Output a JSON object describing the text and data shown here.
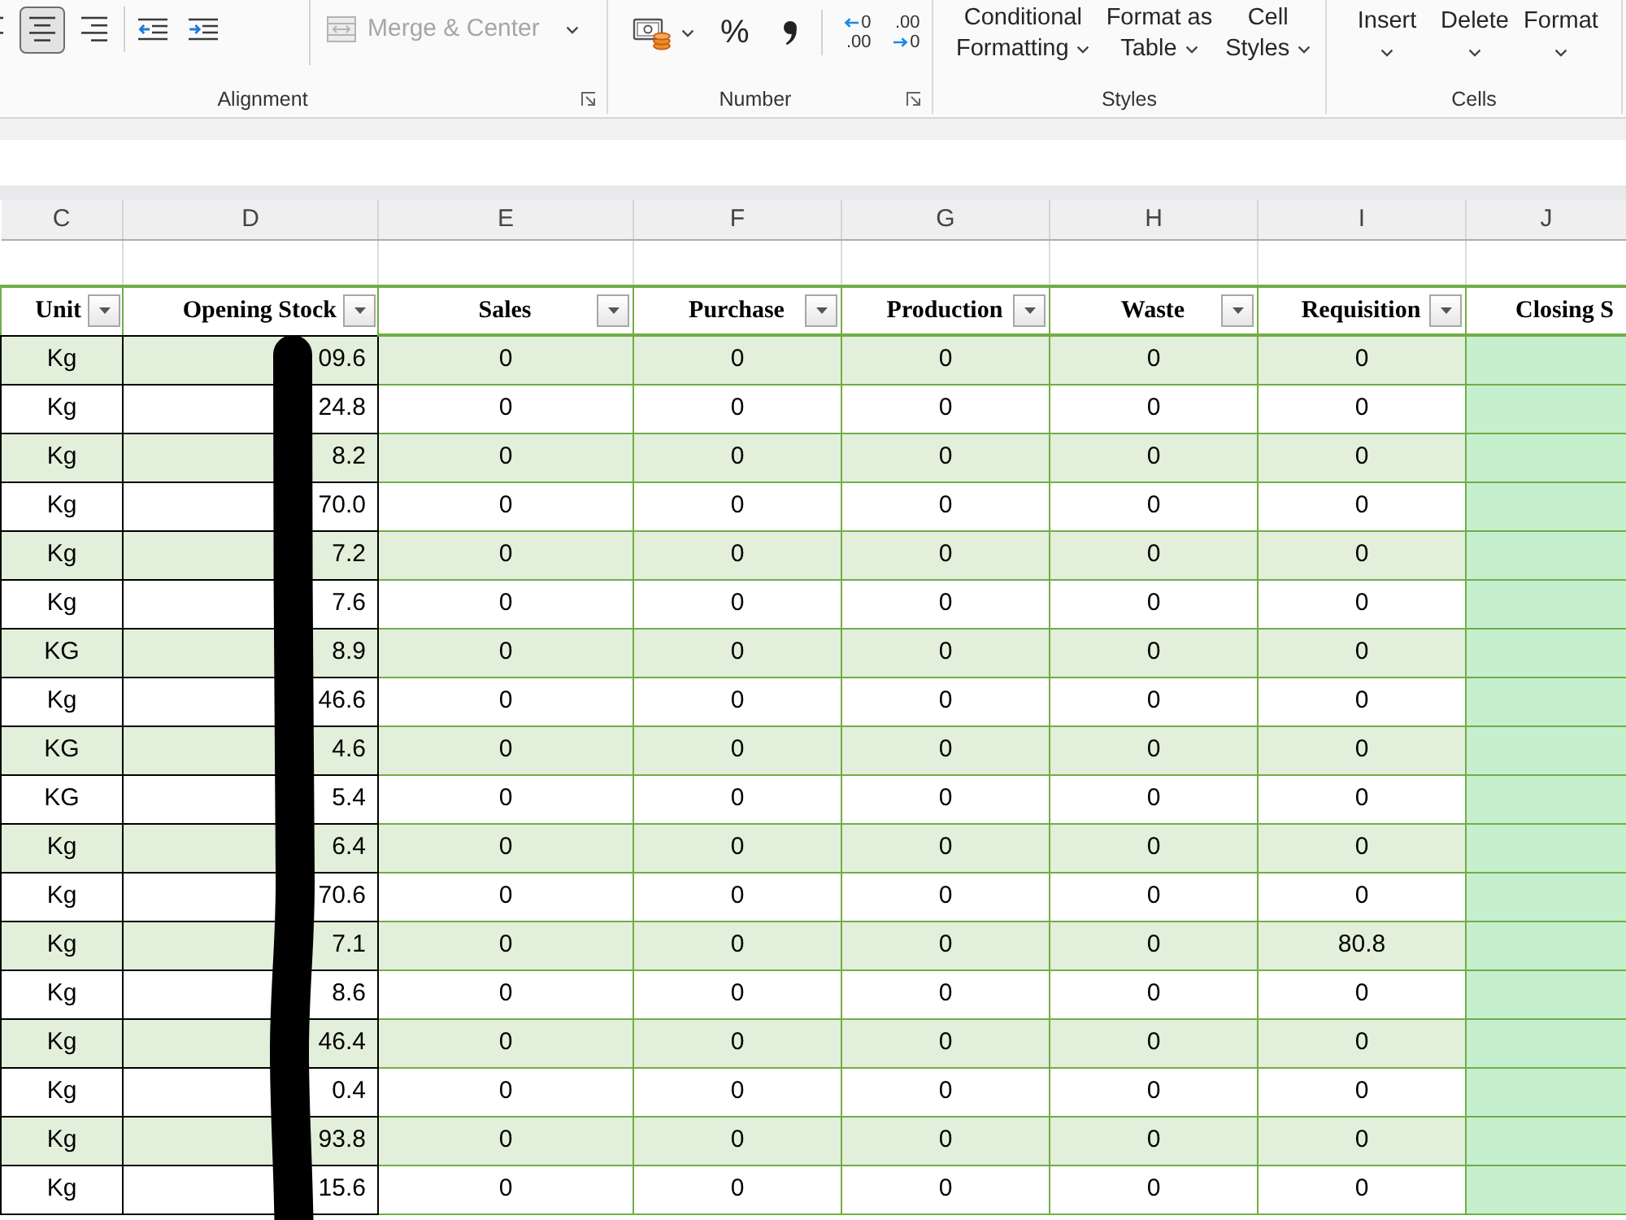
{
  "ribbon": {
    "groups": [
      {
        "kind": "alignment",
        "label": "Alignment",
        "launcher": true,
        "align_buttons": [
          {
            "kind": "left",
            "selected": false
          },
          {
            "kind": "center",
            "selected": true
          },
          {
            "kind": "right",
            "selected": false
          }
        ],
        "indent_buttons": [
          {
            "kind": "decrease"
          },
          {
            "kind": "increase"
          }
        ],
        "merge": {
          "label": "Merge & Center",
          "disabled": true
        }
      },
      {
        "kind": "number",
        "label": "Number",
        "launcher": true,
        "percent": "%",
        "decimal_buttons": [
          {
            "kind": "increase",
            "lines": [
              "0",
              ".00"
            ]
          },
          {
            "kind": "decrease",
            "lines": [
              ".00",
              "0"
            ]
          }
        ]
      },
      {
        "kind": "styles",
        "label": "Styles",
        "launcher": false,
        "buttons": [
          {
            "lines": [
              "Conditional",
              "Formatting"
            ]
          },
          {
            "lines": [
              "Format as",
              "Table"
            ]
          },
          {
            "lines": [
              "Cell",
              "Styles"
            ]
          }
        ]
      },
      {
        "kind": "cells",
        "label": "Cells",
        "launcher": false,
        "buttons": [
          {
            "label": "Insert"
          },
          {
            "label": "Delete"
          },
          {
            "label": "Format"
          }
        ]
      }
    ]
  },
  "sheet": {
    "column_letters": [
      "C",
      "D",
      "E",
      "F",
      "G",
      "H",
      "I",
      "J"
    ],
    "headers": [
      {
        "label": "Unit",
        "filter": true
      },
      {
        "label": "Opening Stock",
        "filter": true
      },
      {
        "label": "Sales",
        "filter": true
      },
      {
        "label": "Purchase",
        "filter": true
      },
      {
        "label": "Production",
        "filter": true
      },
      {
        "label": "Waste",
        "filter": true
      },
      {
        "label": "Requisition",
        "filter": true
      },
      {
        "label": "Closing S",
        "filter": false
      }
    ],
    "rows": [
      [
        "Kg",
        "09.6",
        "0",
        "0",
        "0",
        "0",
        "0"
      ],
      [
        "Kg",
        "24.8",
        "0",
        "0",
        "0",
        "0",
        "0"
      ],
      [
        "Kg",
        "8.2",
        "0",
        "0",
        "0",
        "0",
        "0"
      ],
      [
        "Kg",
        "70.0",
        "0",
        "0",
        "0",
        "0",
        "0"
      ],
      [
        "Kg",
        "7.2",
        "0",
        "0",
        "0",
        "0",
        "0"
      ],
      [
        "Kg",
        "7.6",
        "0",
        "0",
        "0",
        "0",
        "0"
      ],
      [
        "KG",
        "8.9",
        "0",
        "0",
        "0",
        "0",
        "0"
      ],
      [
        "Kg",
        "46.6",
        "0",
        "0",
        "0",
        "0",
        "0"
      ],
      [
        "KG",
        "4.6",
        "0",
        "0",
        "0",
        "0",
        "0"
      ],
      [
        "KG",
        "5.4",
        "0",
        "0",
        "0",
        "0",
        "0"
      ],
      [
        "Kg",
        "6.4",
        "0",
        "0",
        "0",
        "0",
        "0"
      ],
      [
        "Kg",
        "70.6",
        "0",
        "0",
        "0",
        "0",
        "0"
      ],
      [
        "Kg",
        "7.1",
        "0",
        "0",
        "0",
        "0",
        "80.8"
      ],
      [
        "Kg",
        "8.6",
        "0",
        "0",
        "0",
        "0",
        "0"
      ],
      [
        "Kg",
        "46.4",
        "0",
        "0",
        "0",
        "0",
        "0"
      ],
      [
        "Kg",
        "0.4",
        "0",
        "0",
        "0",
        "0",
        "0"
      ],
      [
        "Kg",
        "93.8",
        "0",
        "0",
        "0",
        "0",
        "0"
      ],
      [
        "Kg",
        "15.6",
        "0",
        "0",
        "0",
        "0",
        "0"
      ]
    ]
  }
}
